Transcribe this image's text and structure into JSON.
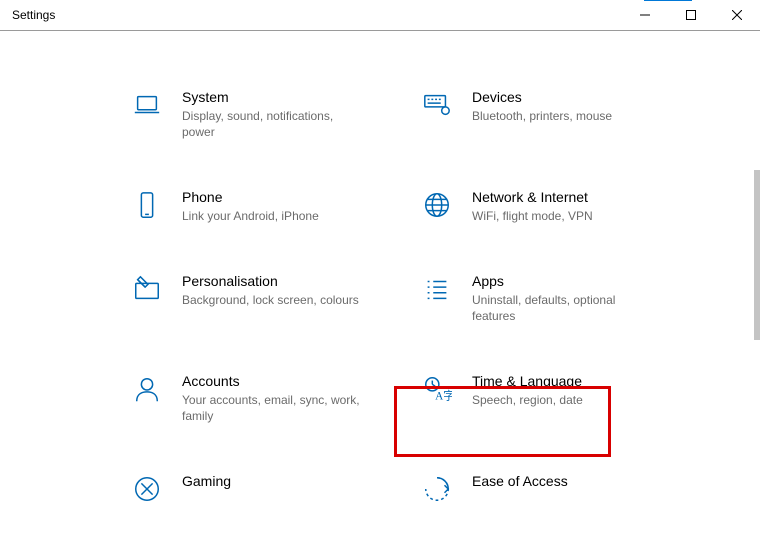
{
  "window": {
    "title": "Settings"
  },
  "categories": [
    {
      "id": "system",
      "title": "System",
      "subtitle": "Display, sound, notifications, power"
    },
    {
      "id": "devices",
      "title": "Devices",
      "subtitle": "Bluetooth, printers, mouse"
    },
    {
      "id": "phone",
      "title": "Phone",
      "subtitle": "Link your Android, iPhone"
    },
    {
      "id": "network",
      "title": "Network & Internet",
      "subtitle": "WiFi, flight mode, VPN"
    },
    {
      "id": "personalisation",
      "title": "Personalisation",
      "subtitle": "Background, lock screen, colours"
    },
    {
      "id": "apps",
      "title": "Apps",
      "subtitle": "Uninstall, defaults, optional features"
    },
    {
      "id": "accounts",
      "title": "Accounts",
      "subtitle": "Your accounts, email, sync, work, family"
    },
    {
      "id": "time_language",
      "title": "Time & Language",
      "subtitle": "Speech, region, date"
    },
    {
      "id": "gaming",
      "title": "Gaming",
      "subtitle": ""
    },
    {
      "id": "ease_of_access",
      "title": "Ease of Access",
      "subtitle": ""
    }
  ],
  "highlighted_category_id": "time_language",
  "colors": {
    "icon": "#0168b3",
    "subtitle": "#6b6b6b",
    "highlight": "#d80000",
    "accent": "#0078d7"
  }
}
